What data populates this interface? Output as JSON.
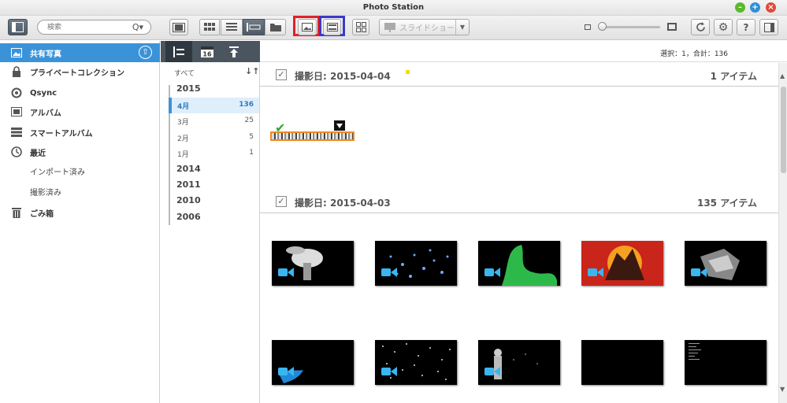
{
  "window": {
    "title": "Photo Station"
  },
  "toolbar": {
    "search_placeholder": "検索",
    "slideshow_label": "スライドショー"
  },
  "sidebar": {
    "items": [
      {
        "label": "共有写真"
      },
      {
        "label": "プライベートコレクション"
      },
      {
        "label": "Qsync"
      },
      {
        "label": "アルバム"
      },
      {
        "label": "スマートアルバム"
      },
      {
        "label": "最近"
      },
      {
        "label": "インポート済み"
      },
      {
        "label": "撮影済み"
      },
      {
        "label": "ごみ箱"
      }
    ]
  },
  "timeline": {
    "all_label": "すべて",
    "years": [
      "2015",
      "2014",
      "2011",
      "2010",
      "2006"
    ],
    "months": [
      {
        "label": "4月",
        "count": "136"
      },
      {
        "label": "3月",
        "count": "25"
      },
      {
        "label": "2月",
        "count": "5"
      },
      {
        "label": "1月",
        "count": "1"
      }
    ]
  },
  "info": {
    "selection": "選択：1，合計：136"
  },
  "groups": [
    {
      "date": "撮影日: 2015-04-04",
      "count": "1 アイテム"
    },
    {
      "date": "撮影日: 2015-04-03",
      "count": "135 アイテム"
    }
  ],
  "colors": {
    "accent": "#3a93d8",
    "highlight_red": "#e0202a",
    "highlight_blue": "#3a3ac8",
    "video_icon": "#3ab5f0"
  }
}
